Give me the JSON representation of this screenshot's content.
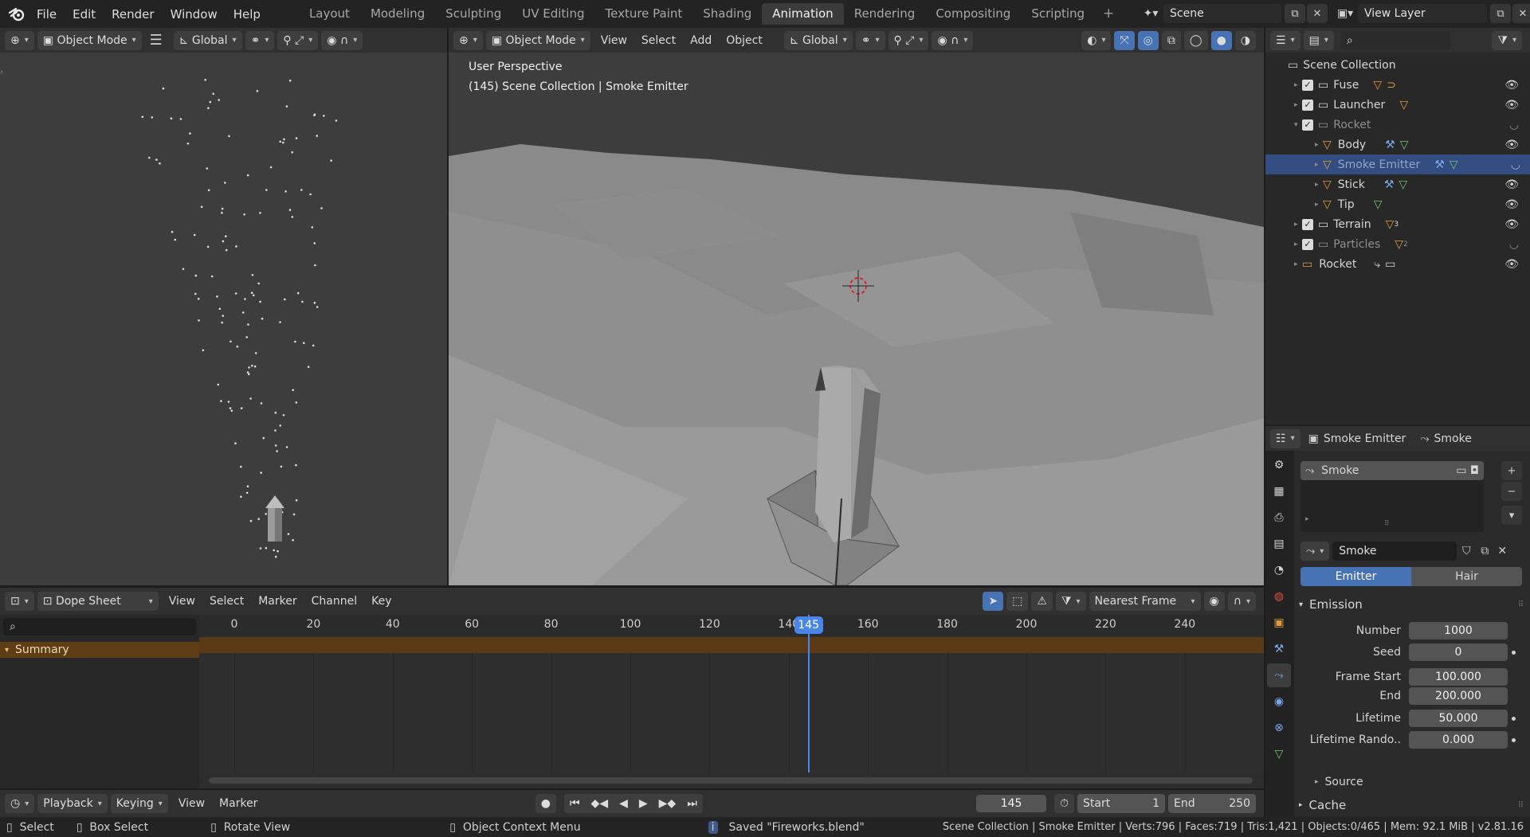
{
  "topbar": {
    "menus": [
      "File",
      "Edit",
      "Render",
      "Window",
      "Help"
    ],
    "workspaces": [
      "Layout",
      "Modeling",
      "Sculpting",
      "UV Editing",
      "Texture Paint",
      "Shading",
      "Animation",
      "Rendering",
      "Compositing",
      "Scripting"
    ],
    "active_workspace": "Animation",
    "scene": "Scene",
    "view_layer": "View Layer"
  },
  "left_viewport": {
    "mode": "Object Mode",
    "orientation": "Global"
  },
  "main_viewport": {
    "mode": "Object Mode",
    "menus": [
      "View",
      "Select",
      "Add",
      "Object"
    ],
    "orientation": "Global",
    "overlay_title": "User Perspective",
    "overlay_subtitle": "(145) Scene Collection | Smoke Emitter"
  },
  "outliner": {
    "root": "Scene Collection",
    "items": [
      {
        "name": "Fuse"
      },
      {
        "name": "Launcher"
      },
      {
        "name": "Rocket"
      },
      {
        "name": "Body"
      },
      {
        "name": "Smoke Emitter"
      },
      {
        "name": "Stick"
      },
      {
        "name": "Tip"
      },
      {
        "name": "Terrain",
        "badge": "3"
      },
      {
        "name": "Particles",
        "badge": "2"
      },
      {
        "name": "Rocket"
      }
    ]
  },
  "properties": {
    "object_name": "Smoke Emitter",
    "modifier_name": "Smoke",
    "list_item": "Smoke",
    "datablock": "Smoke",
    "type_tabs": [
      "Emitter",
      "Hair"
    ],
    "active_type": "Emitter",
    "section": "Emission",
    "fields": [
      {
        "label": "Number",
        "value": "1000",
        "keyed": false
      },
      {
        "label": "Seed",
        "value": "0",
        "keyed": true
      },
      {
        "label": "Frame Start",
        "value": "100.000",
        "keyed": false
      },
      {
        "label": "End",
        "value": "200.000",
        "keyed": false
      },
      {
        "label": "Lifetime",
        "value": "50.000",
        "keyed": true
      },
      {
        "label": "Lifetime Rando..",
        "value": "0.000",
        "keyed": true
      }
    ],
    "subsection": "Source",
    "next_section": "Cache"
  },
  "dopesheet": {
    "editor": "Dope Sheet",
    "menus": [
      "View",
      "Select",
      "Marker",
      "Channel",
      "Key"
    ],
    "snap": "Nearest Frame",
    "summary_label": "Summary",
    "ticks": [
      "0",
      "20",
      "40",
      "60",
      "80",
      "100",
      "120",
      "140",
      "160",
      "180",
      "200",
      "220",
      "240"
    ],
    "current_frame": "145"
  },
  "timeline": {
    "menus": [
      "Playback",
      "Keying",
      "View",
      "Marker"
    ],
    "frame": "145",
    "start_label": "Start",
    "start": "1",
    "end_label": "End",
    "end": "250"
  },
  "statusbar": {
    "select": "Select",
    "box_select": "Box Select",
    "rotate_view": "Rotate View",
    "context_menu": "Object Context Menu",
    "message": "Saved \"Fireworks.blend\"",
    "stats": "Scene Collection | Smoke Emitter | Verts:796 | Faces:719 | Tris:1,421 | Objects:0/465 | Mem: 92.1 MiB | v2.81.16"
  },
  "colors": {
    "accent_blue": "#4772b3",
    "playhead": "#4a86e8",
    "summary_bg": "#5e3d17",
    "selected_row": "#334d80",
    "orange_object": "#e09a3e",
    "green_mesh": "#6ec36e"
  }
}
